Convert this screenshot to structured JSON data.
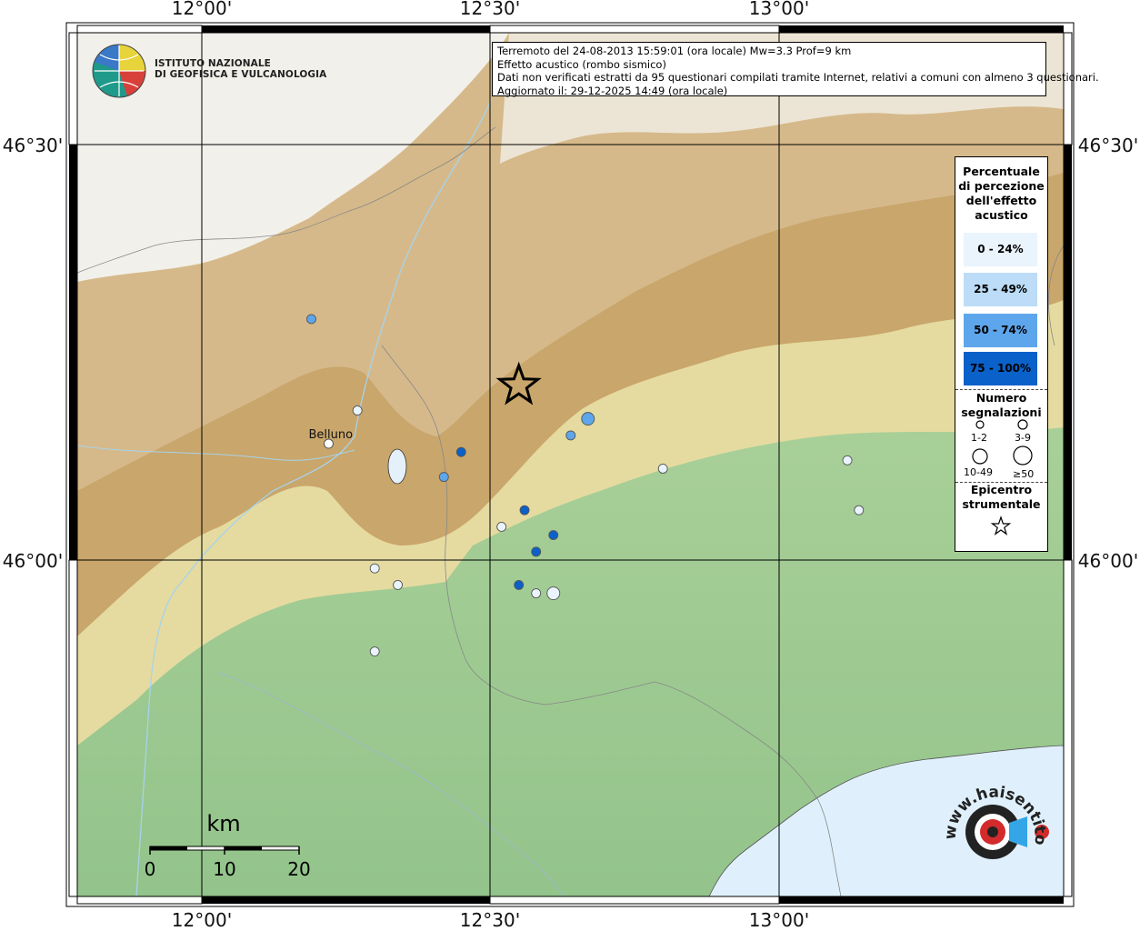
{
  "info": {
    "line1": "Terremoto del 24-08-2013 15:59:01 (ora locale) Mw=3.3 Prof=9 km",
    "line2": "Effetto acustico (rombo sismico)",
    "line3": "Dati non verificati estratti da 95 questionari compilati tramite Internet, relativi a comuni con almeno 3 questionari.",
    "line4": "Aggiornato il: 29-12-2025 14:49 (ora locale)"
  },
  "logo": {
    "line1": "ISTITUTO NAZIONALE",
    "line2": "DI GEOFISICA E VULCANOLOGIA"
  },
  "coords": {
    "top": [
      "12°00'",
      "12°30'",
      "13°00'"
    ],
    "bottom": [
      "12°00'",
      "12°30'",
      "13°00'"
    ],
    "left": [
      "46°30'",
      "46°00'"
    ],
    "right": [
      "46°30'",
      "46°00'"
    ]
  },
  "city": {
    "name": "Belluno"
  },
  "legend": {
    "title_lines": [
      "Percentuale",
      "di percezione",
      "dell'effetto",
      "acustico"
    ],
    "classes": [
      {
        "label": "0 - 24%",
        "color": "#eaf4fd"
      },
      {
        "label": "25 - 49%",
        "color": "#bcdcf7"
      },
      {
        "label": "50 - 74%",
        "color": "#5ea6ec"
      },
      {
        "label": "75 - 100%",
        "color": "#0a61c9"
      }
    ],
    "count_title_lines": [
      "Numero",
      "segnalazioni"
    ],
    "count_labels": [
      "1-2",
      "3-9",
      "10-49",
      "≥50"
    ],
    "epicenter_title_lines": [
      "Epicentro",
      "strumentale"
    ]
  },
  "scale": {
    "unit": "km",
    "ticks": [
      "0",
      "10",
      "20"
    ]
  },
  "watermark": {
    "text": "www.haisentitoilterremoto.it"
  },
  "colors": {
    "alps": "#c9a46a",
    "snow": "#f6f6f6",
    "plain": "#9ccb92",
    "hills": "#e8dea3",
    "sea": "#dff0fc"
  },
  "map_data": {
    "epicenter": {
      "lon": 12.55,
      "lat": 46.21
    },
    "belluno": {
      "lon": 12.22,
      "lat": 46.14
    },
    "observations": [
      {
        "lon": 12.19,
        "lat": 46.29,
        "class": 2,
        "size": 0
      },
      {
        "lon": 12.27,
        "lat": 46.18,
        "class": 0,
        "size": 0
      },
      {
        "lon": 12.45,
        "lat": 46.13,
        "class": 3,
        "size": 0
      },
      {
        "lon": 12.42,
        "lat": 46.1,
        "class": 2,
        "size": 0
      },
      {
        "lon": 12.67,
        "lat": 46.17,
        "class": 2,
        "size": 1
      },
      {
        "lon": 12.64,
        "lat": 46.15,
        "class": 2,
        "size": 0
      },
      {
        "lon": 12.56,
        "lat": 46.06,
        "class": 3,
        "size": 0
      },
      {
        "lon": 12.52,
        "lat": 46.04,
        "class": 0,
        "size": 0
      },
      {
        "lon": 12.61,
        "lat": 46.03,
        "class": 3,
        "size": 0
      },
      {
        "lon": 12.58,
        "lat": 46.01,
        "class": 3,
        "size": 0
      },
      {
        "lon": 12.3,
        "lat": 45.99,
        "class": 0,
        "size": 0
      },
      {
        "lon": 12.34,
        "lat": 45.97,
        "class": 0,
        "size": 0
      },
      {
        "lon": 12.55,
        "lat": 45.97,
        "class": 3,
        "size": 0
      },
      {
        "lon": 12.58,
        "lat": 45.96,
        "class": 0,
        "size": 0
      },
      {
        "lon": 12.61,
        "lat": 45.96,
        "class": 0,
        "size": 1
      },
      {
        "lon": 12.3,
        "lat": 45.89,
        "class": 0,
        "size": 0
      },
      {
        "lon": 12.8,
        "lat": 46.11,
        "class": 0,
        "size": 0
      },
      {
        "lon": 13.12,
        "lat": 46.12,
        "class": 0,
        "size": 0
      },
      {
        "lon": 13.14,
        "lat": 46.06,
        "class": 0,
        "size": 0
      }
    ]
  }
}
